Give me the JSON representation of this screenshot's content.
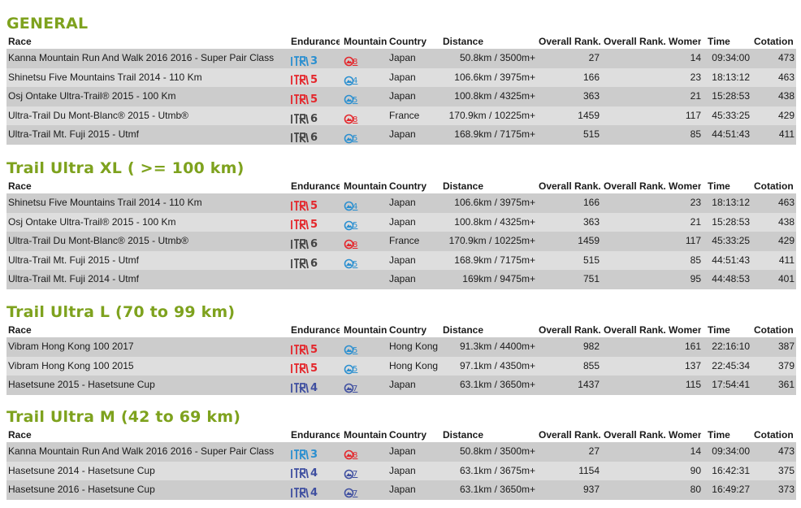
{
  "colors": {
    "title": "#7ea21e",
    "endurance": {
      "3": "#2a8fd0",
      "4": "#3f4fa0",
      "5": "#e4262b",
      "6": "#444444"
    },
    "mountain": {
      "4": "#2a8fd0",
      "5": "#2a8fd0",
      "7": "#3f4fa0",
      "8": "#e4262b"
    },
    "row_alt": "#cccccc",
    "row_plain": "#dedede"
  },
  "header": {
    "race": "Race",
    "endurance": "Endurance",
    "mountain": "Mountain",
    "country": "Country",
    "distance": "Distance",
    "overall_rank": "Overall Rank.",
    "overall_rank_women": "Overall Rank. Women",
    "time": "Time",
    "cotation": "Cotation"
  },
  "sections": [
    {
      "title": "GENERAL",
      "rows": [
        {
          "race": "Kanna Mountain Run And Walk 2016 2016 - Super Pair Class",
          "endurance": "3",
          "mountain": "8",
          "country": "Japan",
          "distance": "50.8km / 3500m+",
          "overall_rank": "27",
          "overall_rank_women": "14",
          "time": "09:34:00",
          "cotation": "473"
        },
        {
          "race": "Shinetsu Five Mountains Trail 2014 - 110 Km",
          "endurance": "5",
          "mountain": "4",
          "country": "Japan",
          "distance": "106.6km / 3975m+",
          "overall_rank": "166",
          "overall_rank_women": "23",
          "time": "18:13:12",
          "cotation": "463"
        },
        {
          "race": "Osj Ontake Ultra-Trail® 2015 - 100 Km",
          "endurance": "5",
          "mountain": "5",
          "country": "Japan",
          "distance": "100.8km / 4325m+",
          "overall_rank": "363",
          "overall_rank_women": "21",
          "time": "15:28:53",
          "cotation": "438"
        },
        {
          "race": "Ultra-Trail Du Mont-Blanc® 2015 - Utmb®",
          "endurance": "6",
          "mountain": "8",
          "country": "France",
          "distance": "170.9km / 10225m+",
          "overall_rank": "1459",
          "overall_rank_women": "117",
          "time": "45:33:25",
          "cotation": "429"
        },
        {
          "race": "Ultra-Trail Mt. Fuji 2015 - Utmf",
          "endurance": "6",
          "mountain": "5",
          "country": "Japan",
          "distance": "168.9km / 7175m+",
          "overall_rank": "515",
          "overall_rank_women": "85",
          "time": "44:51:43",
          "cotation": "411"
        }
      ]
    },
    {
      "title": "Trail Ultra XL ( >= 100 km)",
      "rows": [
        {
          "race": "Shinetsu Five Mountains Trail 2014 - 110 Km",
          "endurance": "5",
          "mountain": "4",
          "country": "Japan",
          "distance": "106.6km / 3975m+",
          "overall_rank": "166",
          "overall_rank_women": "23",
          "time": "18:13:12",
          "cotation": "463"
        },
        {
          "race": "Osj Ontake Ultra-Trail® 2015 - 100 Km",
          "endurance": "5",
          "mountain": "5",
          "country": "Japan",
          "distance": "100.8km / 4325m+",
          "overall_rank": "363",
          "overall_rank_women": "21",
          "time": "15:28:53",
          "cotation": "438"
        },
        {
          "race": "Ultra-Trail Du Mont-Blanc® 2015 - Utmb®",
          "endurance": "6",
          "mountain": "8",
          "country": "France",
          "distance": "170.9km / 10225m+",
          "overall_rank": "1459",
          "overall_rank_women": "117",
          "time": "45:33:25",
          "cotation": "429"
        },
        {
          "race": "Ultra-Trail Mt. Fuji 2015 - Utmf",
          "endurance": "6",
          "mountain": "5",
          "country": "Japan",
          "distance": "168.9km / 7175m+",
          "overall_rank": "515",
          "overall_rank_women": "85",
          "time": "44:51:43",
          "cotation": "411"
        },
        {
          "race": "Ultra-Trail Mt. Fuji 2014 - Utmf",
          "endurance": "",
          "mountain": "",
          "country": "Japan",
          "distance": "169km / 9475m+",
          "overall_rank": "751",
          "overall_rank_women": "95",
          "time": "44:48:53",
          "cotation": "401"
        }
      ]
    },
    {
      "title": "Trail Ultra L (70 to 99 km)",
      "rows": [
        {
          "race": "Vibram Hong Kong 100 2017",
          "endurance": "5",
          "mountain": "5",
          "country": "Hong Kong",
          "distance": "91.3km / 4400m+",
          "overall_rank": "982",
          "overall_rank_women": "161",
          "time": "22:16:10",
          "cotation": "387"
        },
        {
          "race": "Vibram Hong Kong 100 2015",
          "endurance": "5",
          "mountain": "5",
          "country": "Hong Kong",
          "distance": "97.1km / 4350m+",
          "overall_rank": "855",
          "overall_rank_women": "137",
          "time": "22:45:34",
          "cotation": "379"
        },
        {
          "race": "Hasetsune 2015 - Hasetsune Cup",
          "endurance": "4",
          "mountain": "7",
          "country": "Japan",
          "distance": "63.1km / 3650m+",
          "overall_rank": "1437",
          "overall_rank_women": "115",
          "time": "17:54:41",
          "cotation": "361"
        }
      ]
    },
    {
      "title": "Trail Ultra M (42 to 69 km)",
      "rows": [
        {
          "race": "Kanna Mountain Run And Walk 2016 2016 - Super Pair Class",
          "endurance": "3",
          "mountain": "8",
          "country": "Japan",
          "distance": "50.8km / 3500m+",
          "overall_rank": "27",
          "overall_rank_women": "14",
          "time": "09:34:00",
          "cotation": "473"
        },
        {
          "race": "Hasetsune 2014 - Hasetsune Cup",
          "endurance": "4",
          "mountain": "7",
          "country": "Japan",
          "distance": "63.1km / 3675m+",
          "overall_rank": "1154",
          "overall_rank_women": "90",
          "time": "16:42:31",
          "cotation": "375"
        },
        {
          "race": "Hasetsune 2016 - Hasetsune Cup",
          "endurance": "4",
          "mountain": "7",
          "country": "Japan",
          "distance": "63.1km / 3650m+",
          "overall_rank": "937",
          "overall_rank_women": "80",
          "time": "16:49:27",
          "cotation": "373"
        }
      ]
    }
  ]
}
